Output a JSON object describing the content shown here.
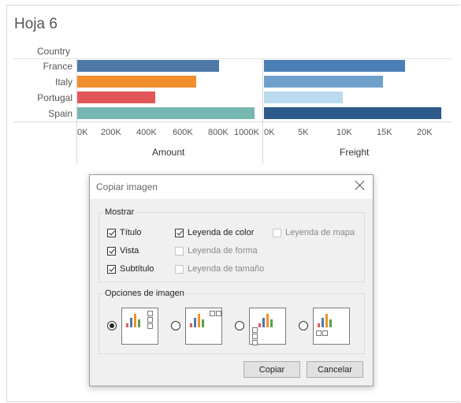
{
  "sheet": {
    "title": "Hoja 6"
  },
  "chart_data": {
    "type": "bar",
    "orientation": "horizontal",
    "row_header": "Country",
    "categories": [
      "France",
      "Italy",
      "Portugal",
      "Spain"
    ],
    "panels": [
      {
        "measure": "Amount",
        "values": [
          800000,
          670000,
          440000,
          1000000
        ],
        "xlim": [
          0,
          1000000
        ],
        "ticks": [
          "0K",
          "200K",
          "400K",
          "600K",
          "800K",
          "1000K"
        ],
        "colors": [
          "#4e79a7",
          "#f28e2b",
          "#e15759",
          "#76b7b2"
        ]
      },
      {
        "measure": "Freight",
        "values": [
          17500,
          14800,
          9800,
          22000
        ],
        "xlim": [
          0,
          22000
        ],
        "ticks": [
          "0K",
          "5K",
          "10K",
          "15K",
          "20K"
        ],
        "colors": [
          "#4a7fb5",
          "#6fa0cc",
          "#b9daef",
          "#2c5a8a"
        ]
      }
    ]
  },
  "dialog": {
    "title": "Copiar imagen",
    "show_group": {
      "label": "Mostrar",
      "options": [
        {
          "label": "Título",
          "checked": true,
          "enabled": true
        },
        {
          "label": "Vista",
          "checked": true,
          "enabled": true
        },
        {
          "label": "Subtítulo",
          "checked": true,
          "enabled": true
        },
        {
          "label": "Leyenda de color",
          "checked": true,
          "enabled": true
        },
        {
          "label": "Leyenda de forma",
          "checked": false,
          "enabled": false
        },
        {
          "label": "Leyenda de tamaño",
          "checked": false,
          "enabled": false
        },
        {
          "label": "Leyenda de mapa",
          "checked": false,
          "enabled": false
        }
      ]
    },
    "image_group": {
      "label": "Opciones de imagen",
      "selected_index": 0,
      "layouts": [
        "legend-right",
        "legend-top-right",
        "legend-left-bottom",
        "legend-bottom-left"
      ]
    },
    "buttons": {
      "copy": "Copiar",
      "cancel": "Cancelar"
    }
  }
}
